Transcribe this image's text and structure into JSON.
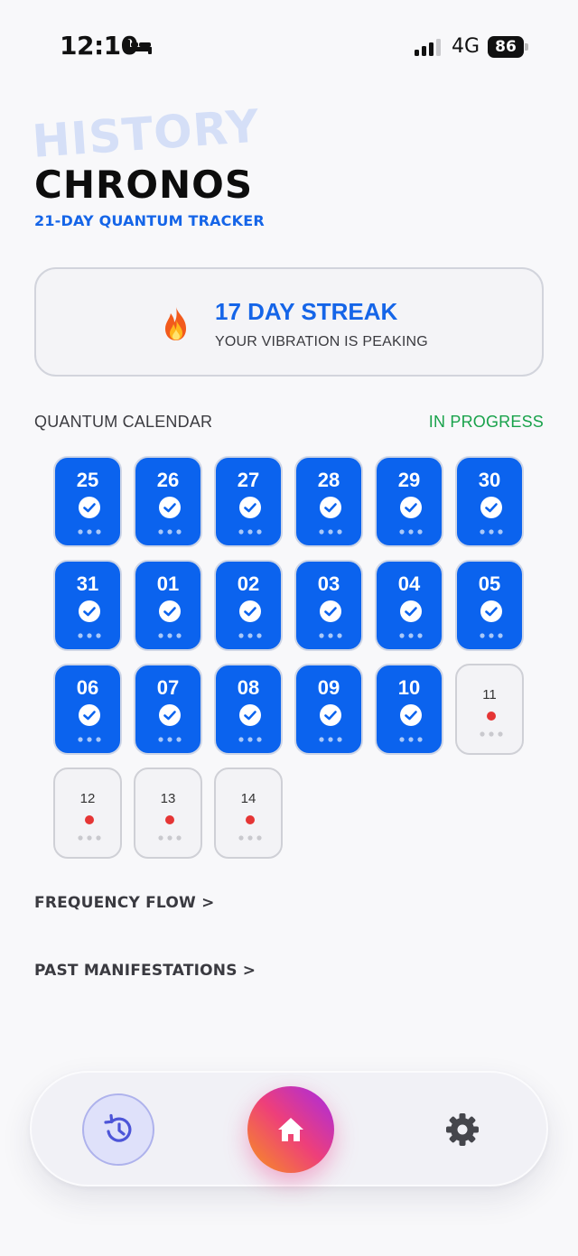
{
  "status_bar": {
    "time": "12:10",
    "network": "4G",
    "battery": "86"
  },
  "header": {
    "watermark": "HISTORY",
    "title": "CHRONOS",
    "subtitle": "21-DAY QUANTUM TRACKER"
  },
  "streak": {
    "title": "17 DAY STREAK",
    "text": "YOUR VIBRATION IS PEAKING"
  },
  "calendar": {
    "label": "QUANTUM CALENDAR",
    "status": "IN PROGRESS",
    "days": [
      {
        "day": "25",
        "done": true
      },
      {
        "day": "26",
        "done": true
      },
      {
        "day": "27",
        "done": true
      },
      {
        "day": "28",
        "done": true
      },
      {
        "day": "29",
        "done": true
      },
      {
        "day": "30",
        "done": true
      },
      {
        "day": "31",
        "done": true
      },
      {
        "day": "01",
        "done": true
      },
      {
        "day": "02",
        "done": true
      },
      {
        "day": "03",
        "done": true
      },
      {
        "day": "04",
        "done": true
      },
      {
        "day": "05",
        "done": true
      },
      {
        "day": "06",
        "done": true
      },
      {
        "day": "07",
        "done": true
      },
      {
        "day": "08",
        "done": true
      },
      {
        "day": "09",
        "done": true
      },
      {
        "day": "10",
        "done": true
      },
      {
        "day": "11",
        "done": false
      },
      {
        "day": "12",
        "done": false
      },
      {
        "day": "13",
        "done": false
      },
      {
        "day": "14",
        "done": false
      }
    ]
  },
  "links": {
    "frequency_flow": "FREQUENCY FLOW >",
    "past_manifestations": "PAST MANIFESTATIONS >"
  },
  "nav": {
    "items": [
      "history-icon",
      "home-icon",
      "gear-icon"
    ]
  },
  "colors": {
    "accent": "#1565e8",
    "done_cell": "#0b63ee",
    "in_progress": "#19a24b",
    "pending_dot": "#e53535"
  }
}
